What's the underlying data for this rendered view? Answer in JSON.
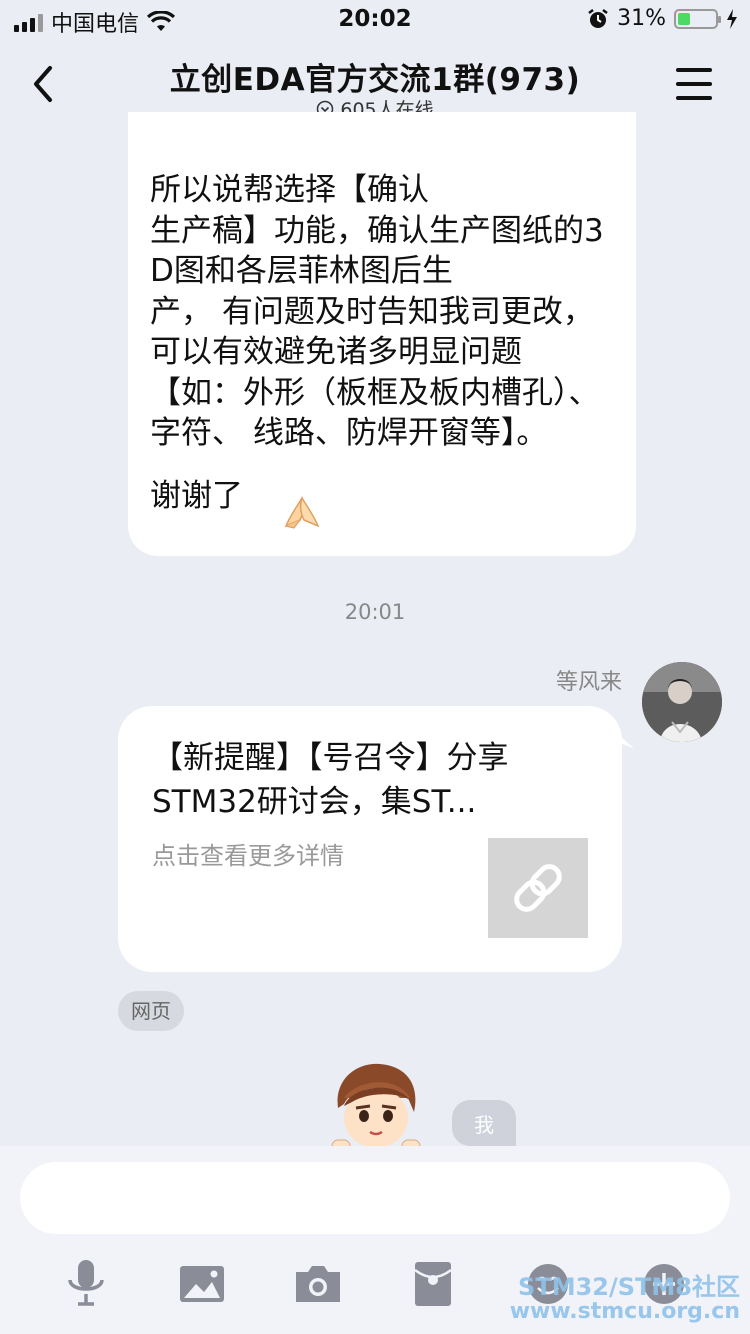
{
  "status_bar": {
    "carrier": "中国电信",
    "time": "20:02",
    "battery_percent": "31%",
    "battery_level": 0.31,
    "icons": [
      "signal-icon",
      "wifi-icon",
      "alarm-icon",
      "battery-icon",
      "charging-icon"
    ]
  },
  "header": {
    "title": "立创EDA官方交流1群(973)",
    "online": "605人在线",
    "back_icon": "chevron-left-icon",
    "menu_icon": "hamburger-menu-icon"
  },
  "messages": [
    {
      "type": "text",
      "text": "所以说帮选择【确认\n生产稿】功能，确认生产图纸的3D图和各层菲林图后生\n产， 有问题及时告知我司更改，可以有效避免诸多明显问题【如：外形（板框及板内槽孔）、字符、 线路、防焊开窗等】。\n谢谢了",
      "emoji": "pray-emoji"
    }
  ],
  "timestamp": "20:01",
  "link_message": {
    "sender": "等风来",
    "title": "【新提醒】【号召令】分享STM32研讨会，集ST...",
    "desc": "点击查看更多详情",
    "thumb_icon": "link-icon",
    "tag": "网页"
  },
  "me_label": "我",
  "toolbar": {
    "icons": [
      "microphone-icon",
      "image-icon",
      "camera-icon",
      "red-packet-icon",
      "emoji-icon",
      "plus-icon"
    ]
  },
  "watermark": {
    "line1": "STM32/STM8社区",
    "line2": "www.stmcu.org.cn"
  }
}
